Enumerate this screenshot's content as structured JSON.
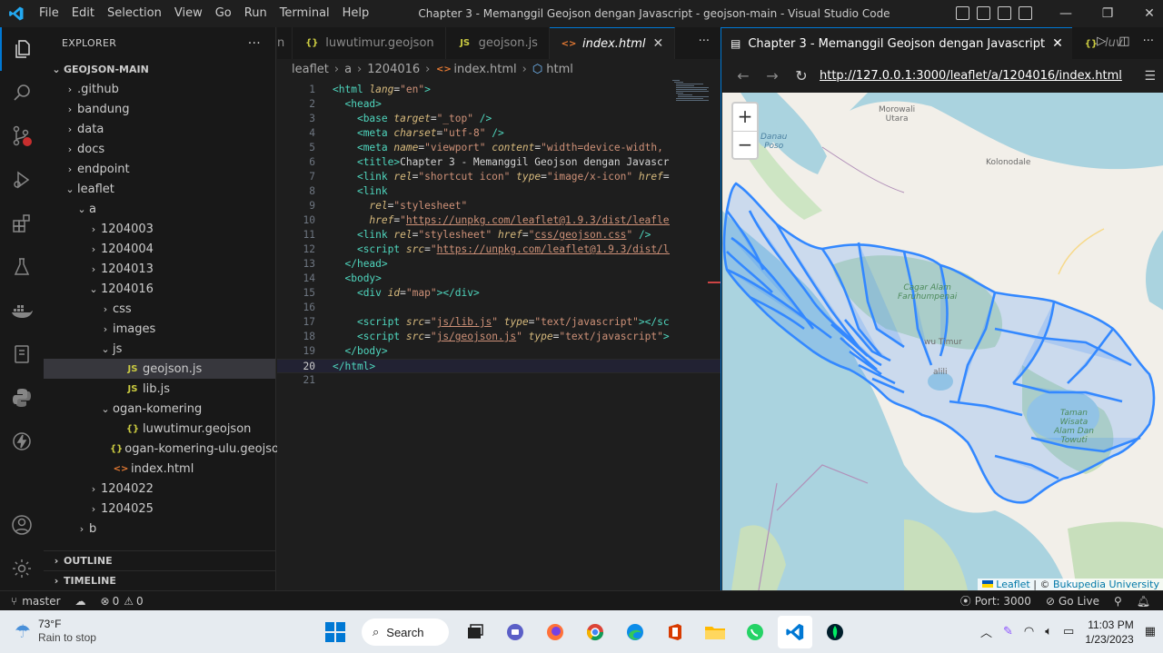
{
  "window": {
    "title": "Chapter 3 - Memanggil Geojson dengan Javascript - geojson-main - Visual Studio Code",
    "menu": [
      "File",
      "Edit",
      "Selection",
      "View",
      "Go",
      "Run",
      "Terminal",
      "Help"
    ],
    "controls": [
      "—",
      "❐",
      "✕"
    ]
  },
  "activity_bar": [
    "files-icon",
    "search-icon",
    "source-control-icon",
    "run-debug-icon",
    "extensions-icon",
    "testing-icon",
    "docker-icon",
    "notebook-icon",
    "python-icon",
    "thunder-icon"
  ],
  "sidebar": {
    "title": "EXPLORER",
    "more": "···",
    "root": "GEOJSON-MAIN",
    "items": [
      {
        "label": ".github",
        "depth": 1,
        "chev": "›",
        "icon": ""
      },
      {
        "label": "bandung",
        "depth": 1,
        "chev": "›",
        "icon": ""
      },
      {
        "label": "data",
        "depth": 1,
        "chev": "›",
        "icon": ""
      },
      {
        "label": "docs",
        "depth": 1,
        "chev": "›",
        "icon": ""
      },
      {
        "label": "endpoint",
        "depth": 1,
        "chev": "›",
        "icon": ""
      },
      {
        "label": "leaflet",
        "depth": 1,
        "chev": "⌄",
        "icon": ""
      },
      {
        "label": "a",
        "depth": 2,
        "chev": "⌄",
        "icon": ""
      },
      {
        "label": "1204003",
        "depth": 3,
        "chev": "›",
        "icon": ""
      },
      {
        "label": "1204004",
        "depth": 3,
        "chev": "›",
        "icon": ""
      },
      {
        "label": "1204013",
        "depth": 3,
        "chev": "›",
        "icon": ""
      },
      {
        "label": "1204016",
        "depth": 3,
        "chev": "⌄",
        "icon": ""
      },
      {
        "label": "css",
        "depth": 4,
        "chev": "›",
        "icon": ""
      },
      {
        "label": "images",
        "depth": 4,
        "chev": "›",
        "icon": ""
      },
      {
        "label": "js",
        "depth": 4,
        "chev": "⌄",
        "icon": ""
      },
      {
        "label": "geojson.js",
        "depth": 5,
        "chev": "",
        "icon": "JS",
        "selected": true
      },
      {
        "label": "lib.js",
        "depth": 5,
        "chev": "",
        "icon": "JS"
      },
      {
        "label": "ogan-komering",
        "depth": 4,
        "chev": "⌄",
        "icon": ""
      },
      {
        "label": "luwutimur.geojson",
        "depth": 5,
        "chev": "",
        "icon": "{}"
      },
      {
        "label": "ogan-komering-ulu.geojson",
        "depth": 5,
        "chev": "",
        "icon": "{}"
      },
      {
        "label": "index.html",
        "depth": 4,
        "chev": "",
        "icon": "<>"
      },
      {
        "label": "1204022",
        "depth": 3,
        "chev": "›",
        "icon": ""
      },
      {
        "label": "1204025",
        "depth": 3,
        "chev": "›",
        "icon": ""
      },
      {
        "label": "b",
        "depth": 2,
        "chev": "›",
        "icon": ""
      }
    ],
    "outline": "OUTLINE",
    "timeline": "TIMELINE"
  },
  "editor": {
    "tabs": [
      {
        "label": "n",
        "icon": "",
        "active": false
      },
      {
        "label": "luwutimur.geojson",
        "icon": "{}",
        "active": false
      },
      {
        "label": "geojson.js",
        "icon": "JS",
        "active": false
      },
      {
        "label": "index.html",
        "icon": "<>",
        "active": true,
        "close": "✕"
      }
    ],
    "tabs_more": "···",
    "breadcrumb": [
      "leaflet",
      "a",
      "1204016",
      "index.html",
      "html"
    ],
    "current_line": 20
  },
  "browser": {
    "tab_title": "Chapter 3 - Memanggil Geojson dengan Javascript",
    "tab_close": "✕",
    "second_tab": "luv",
    "url": "http://127.0.0.1:3000/leaflet/a/1204016/index.html",
    "zoom_in": "+",
    "zoom_out": "−",
    "attribution_leaflet": "Leaflet",
    "attribution_sep": " | © ",
    "attribution_source": "Bukupedia University",
    "labels": {
      "morowali": "Morowali\nUtara",
      "danau_poso": "Danau\nPoso",
      "kolonodale": "Kolonodale",
      "cagar_alam": "Cagar Alam\nFaruhumpenai",
      "luwu_timur": "wu Timur",
      "malili": "alili",
      "taman_wisata": "Taman\nWisata\nAlam Dan\nTowuti"
    }
  },
  "statusbar": {
    "branch": "master",
    "errors": "0",
    "warnings": "0",
    "port": "Port: 3000",
    "golive": "Go Live"
  },
  "taskbar": {
    "temp": "73°F",
    "weather": "Rain to stop",
    "search": "Search",
    "time": "11:03 PM",
    "date": "1/23/2023"
  },
  "colors": {
    "accent": "#0078d4",
    "geojson_stroke": "#3388ff",
    "geojson_fill": "#3388ff"
  }
}
